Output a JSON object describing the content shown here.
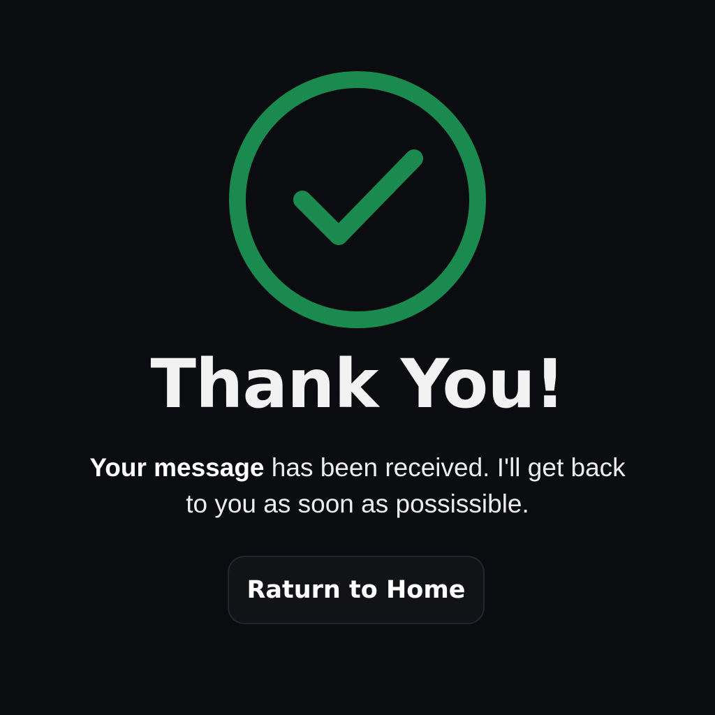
{
  "icon": {
    "name": "checkmark-circle-icon",
    "color": "#1b8a4f"
  },
  "title": "Thank You!",
  "message": {
    "bold": "Your message",
    "rest": " has been received. I'll get back to you as soon as possissible."
  },
  "button": {
    "label": "Raturn to Home"
  },
  "colors": {
    "background": "#0b0c10",
    "accent": "#1b8a4f",
    "text": "#f2f2f2",
    "button_bg": "#111317",
    "button_border": "#23262c"
  }
}
